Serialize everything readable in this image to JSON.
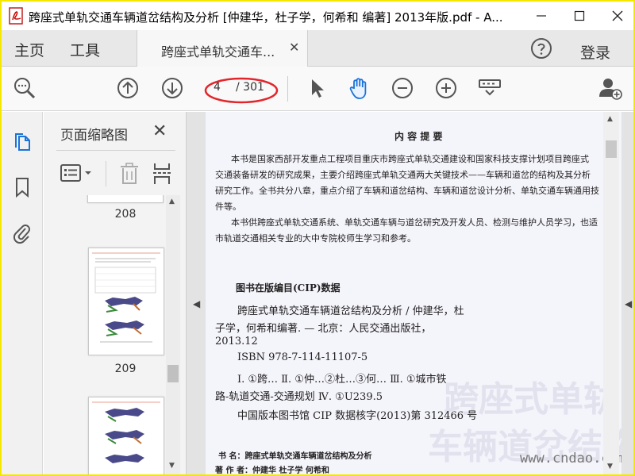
{
  "window": {
    "title": "跨座式单轨交通车辆道岔结构及分析 [仲建华，杜子学，何希和 编著] 2013年版.pdf - A..."
  },
  "menubar": {
    "home": "主页",
    "tools": "工具",
    "doc_tab": "跨座式单轨交通车...",
    "login": "登录"
  },
  "toolbar": {
    "page_current": "4",
    "page_total": "/ 301"
  },
  "thumb_panel": {
    "title": "页面缩略图",
    "pages": [
      "208",
      "209"
    ]
  },
  "document": {
    "heading": "内 容 提 要",
    "summary_lines": [
      "本书是国家西部开发重点工程项目重庆市跨座式单轨交通建设和国家科技支撑计划项目跨座式",
      "交通装备研发的研究成果，主要介绍跨座式单轨交通两大关键技术——车辆和道岔的结构及其分析",
      "研究工作。全书共分八章，重点介绍了车辆和道岔结构、车辆和道岔设计分析、单轨交通车辆通用技",
      "件等。",
      "本书供跨座式单轨交通系统、单轨交通车辆与道岔研究及开发人员、检测与维护人员学习，也适",
      "市轨道交通相关专业的大中专院校师生学习和参考。"
    ],
    "cip_title": "图书在版编目(CIP)数据",
    "cip_lines": [
      "跨座式单轨交通车辆道岔结构及分析 / 仲建华，杜",
      "子学，何希和编著. — 北京：人民交通出版社，",
      "2013.12",
      "ISBN 978-7-114-11107-5",
      "Ⅰ. ①跨…  Ⅱ. ①仲…②杜…③何…  Ⅲ. ①城市铁",
      "路-轨道交通-交通规划 Ⅳ. ①U239.5",
      "中国版本图书馆 CIP 数据核字(2013)第 312466 号"
    ],
    "book_label": "书    名：跨座式单轨交通车辆道岔结构及分析",
    "author_label": "著 作 者：仲建华   杜子学   何希和",
    "watermark": "www.cndao.com"
  }
}
